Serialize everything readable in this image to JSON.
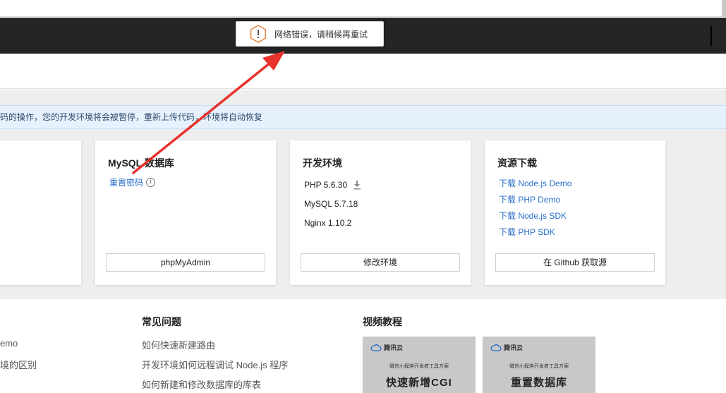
{
  "toast": {
    "message": "网络错误，请稍候再重试",
    "icon": "warning-hexagon-icon"
  },
  "notice": {
    "text": "码的操作，您的开发环境将会被暂停，重新上传代码，环境将自动恢复"
  },
  "mysql_card": {
    "title": "MySQL 数据库",
    "reset_link": "重置密码",
    "button": "phpMyAdmin"
  },
  "env_card": {
    "title": "开发环境",
    "items": [
      "PHP 5.6.30",
      "MySQL 5.7.18",
      "Nginx 1.10.2"
    ],
    "button": "修改环境"
  },
  "res_card": {
    "title": "资源下载",
    "links": [
      "下载 Node.js Demo",
      "下载 PHP Demo",
      "下载 Node.js SDK",
      "下载 PHP SDK"
    ],
    "button": "在 Github 获取源"
  },
  "left_list": [
    "emo",
    "境的区别"
  ],
  "faq": {
    "title": "常见问题",
    "items": [
      "如何快速新建路由",
      "开发环境如何远程调试 Node.js 程序",
      "如何新建和修改数据库的库表"
    ]
  },
  "videos": {
    "title": "视频教程",
    "items": [
      {
        "brand": "腾讯云",
        "sub": "微信小程序开发者工具方案",
        "big": "快速新增CGI"
      },
      {
        "brand": "腾讯云",
        "sub": "微信小程序开发者工具方案",
        "big": "重置数据库"
      }
    ]
  },
  "colors": {
    "link": "#2a6ec9",
    "dark_bar": "#252525",
    "notice_bg": "#e6f1fd",
    "arrow": "#e8322c"
  }
}
